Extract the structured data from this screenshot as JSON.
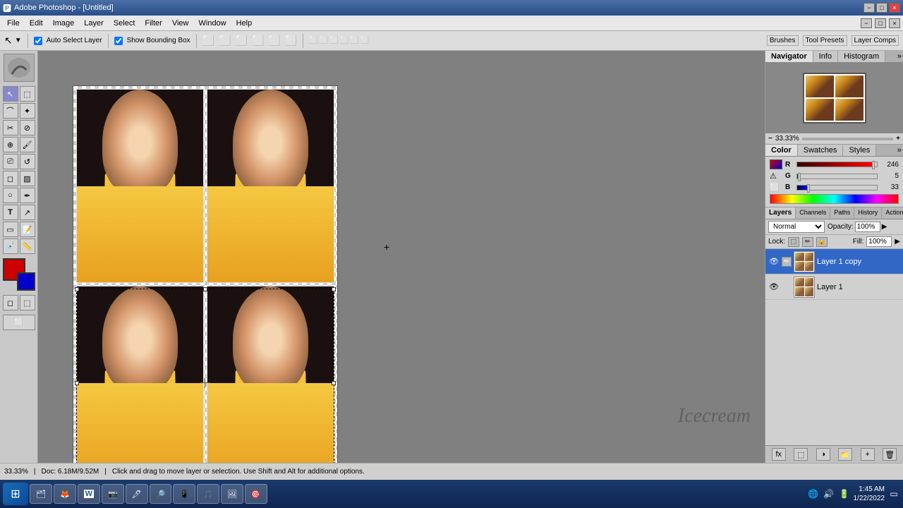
{
  "titlebar": {
    "title": "Adobe Photoshop - [Untitled]",
    "minimize": "−",
    "maximize": "□",
    "close": "×",
    "app_minimize": "−",
    "app_maximize": "□",
    "app_close": "×"
  },
  "menubar": {
    "items": [
      "File",
      "Edit",
      "Image",
      "Layer",
      "Select",
      "Filter",
      "View",
      "Window",
      "Help"
    ]
  },
  "toolbar": {
    "auto_select_label": "Auto Select Layer",
    "bounding_box_label": "Show Bounding Box"
  },
  "top_buttons": {
    "brushes": "Brushes",
    "tool_presets": "Tool Presets",
    "layer_comps": "Layer Comps"
  },
  "navigator": {
    "tab_navigator": "Navigator",
    "tab_info": "Info",
    "tab_histogram": "Histogram",
    "zoom_level": "33.33%"
  },
  "color": {
    "tab_color": "Color",
    "tab_swatches": "Swatches",
    "tab_styles": "Styles",
    "r_label": "R",
    "r_value": "246",
    "g_label": "G",
    "g_value": "5",
    "b_label": "B",
    "b_value": "33"
  },
  "layers": {
    "tab_layers": "Layers",
    "tab_channels": "Channels",
    "tab_paths": "Paths",
    "tab_history": "History",
    "tab_actions": "Actions",
    "blend_mode": "Normal",
    "opacity_label": "Opacity:",
    "opacity_value": "100%",
    "fill_label": "Fill:",
    "fill_value": "100%",
    "lock_label": "Lock:",
    "items": [
      {
        "name": "Layer 1 copy",
        "active": true
      },
      {
        "name": "Layer 1",
        "active": false
      }
    ]
  },
  "statusbar": {
    "zoom": "33.33%",
    "doc_info": "Doc: 6.18M/9.52M",
    "hint": "Click and drag to move layer or selection.  Use Shift and Alt for additional options."
  },
  "taskbar": {
    "time": "1:45 AM",
    "date": "1/22/2022",
    "apps": [
      "⊞",
      "🗂",
      "🦊",
      "W",
      "📷",
      "🖊",
      "🔎",
      "📱",
      "🎵",
      "🖼",
      "🎯"
    ]
  },
  "watermark": "Icecream"
}
